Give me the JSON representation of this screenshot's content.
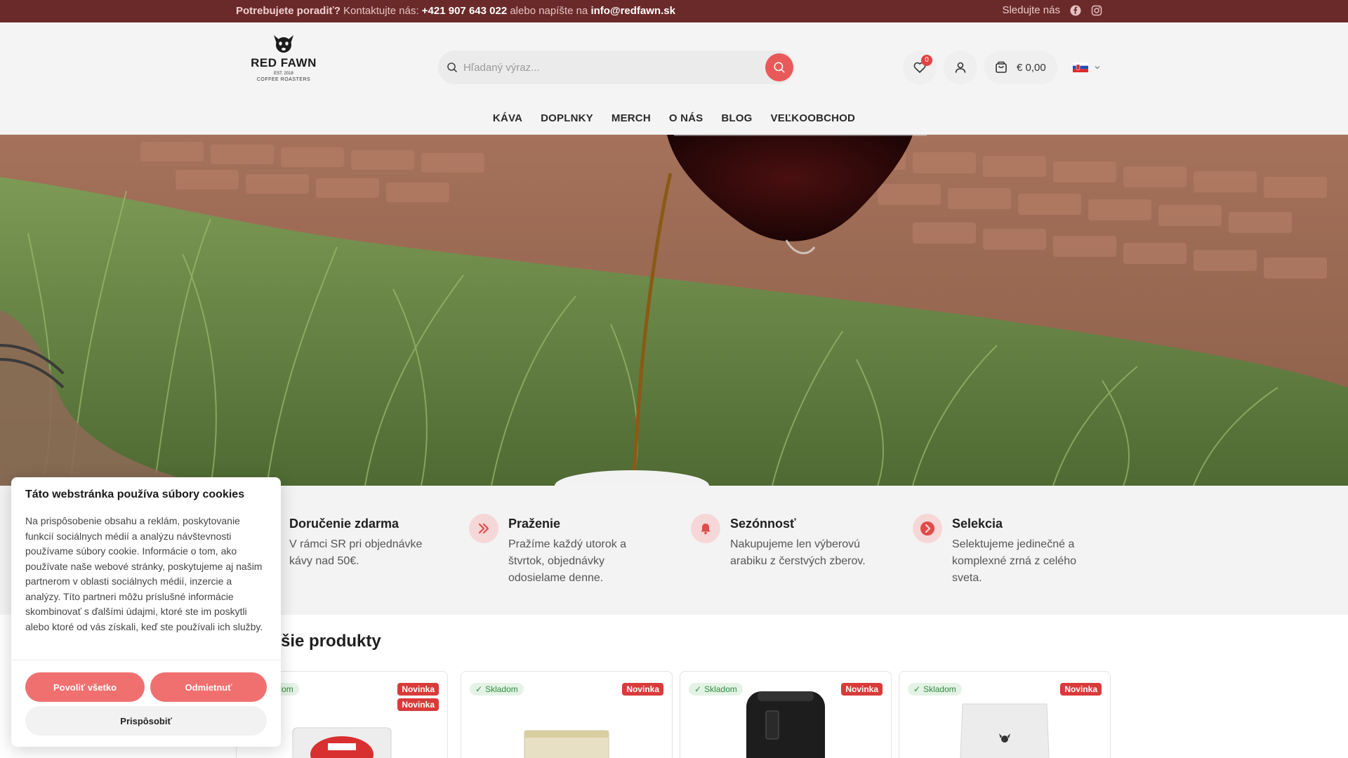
{
  "topbar": {
    "lead": "Potrebujete poradiť?",
    "contact_text": "Kontaktujte nás:",
    "phone": "+421 907 643 022",
    "or_text": "alebo napíšte na",
    "email": "info@redfawn.sk",
    "follow_label": "Sledujte nás"
  },
  "logo": {
    "brand": "RED FAWN",
    "est": "EST. 2018",
    "sub": "COFFEE ROASTERS"
  },
  "search": {
    "placeholder": "Hľadaný výraz..."
  },
  "header": {
    "wishlist_count": "0",
    "cart_total": "€ 0,00"
  },
  "nav": {
    "items": [
      "KÁVA",
      "DOPLNKY",
      "MERCH",
      "O NÁS",
      "BLOG",
      "VEĽKOOBCHOD"
    ]
  },
  "features": [
    {
      "title": "Doručenie zdarma",
      "text": "V rámci SR pri objednávke kávy nad 50€.",
      "icon": "truck-icon"
    },
    {
      "title": "Praženie",
      "text": "Pražíme každý utorok a štvrtok, objednávky odosielame denne.",
      "icon": "chevrons-right-icon"
    },
    {
      "title": "Sezónnosť",
      "text": "Nakupujeme len výberovú arabiku z čerstvých zberov.",
      "icon": "bell-icon"
    },
    {
      "title": "Selekcia",
      "text": "Selektujeme jedinečné a komplexné zrná z celého sveta.",
      "icon": "chevron-right-circle-icon"
    }
  ],
  "products": {
    "title": "ovšie produkty",
    "items": [
      {
        "stock": "Skladom",
        "tags": [
          "Novinka",
          "Novinka"
        ]
      },
      {
        "stock": "Skladom",
        "tags": [
          "Novinka"
        ]
      },
      {
        "stock": "Skladom",
        "tags": [
          "Novinka"
        ]
      },
      {
        "stock": "Skladom",
        "tags": [
          "Novinka"
        ]
      }
    ]
  },
  "cookie": {
    "title": "Táto webstránka používa súbory cookies",
    "text": "Na prispôsobenie obsahu a reklám, poskytovanie funkcií sociálnych médií a analýzu návštevnosti používame súbory cookie. Informácie o tom, ako používate naše webové stránky, poskytujeme aj našim partnerom v oblasti sociálnych médií, inzercie a analýzy. Títo partneri môžu príslušné informácie skombinovať s ďalšími údajmi, ktoré ste im poskytli alebo ktoré od vás získali, keď ste používali ich služby.",
    "allow_label": "Povoliť všetko",
    "deny_label": "Odmietnuť",
    "customize_label": "Prispôsobiť"
  },
  "colors": {
    "topbar": "#6b2a2a",
    "accent": "#e85a5a",
    "badge": "#d93a3a",
    "stock_green": "#2e8b3e"
  }
}
